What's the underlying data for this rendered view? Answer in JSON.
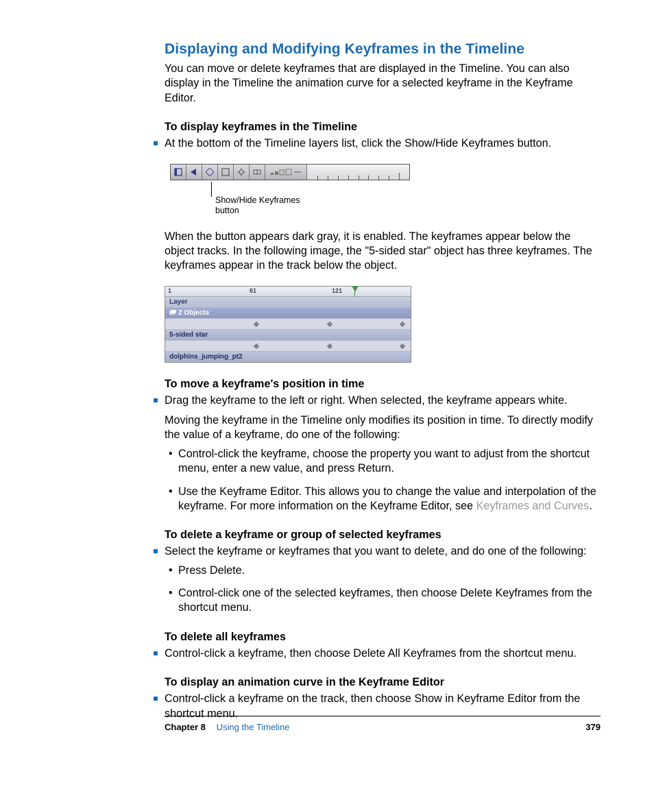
{
  "heading": "Displaying and Modifying Keyframes in the Timeline",
  "intro": "You can move or delete keyframes that are displayed in the Timeline. You can also display in the Timeline the animation curve for a selected keyframe in the Keyframe Editor.",
  "sec1": {
    "title": "To display keyframes in the Timeline",
    "bullet": "At the bottom of the Timeline layers list, click the Show/Hide Keyframes button."
  },
  "callout1": "Show/Hide Keyframes button",
  "after_fig1": "When the button appears dark gray, it is enabled. The keyframes appear below the object tracks. In the following image, the \"5-sided star\" object has three keyframes. The keyframes appear in the track below the object.",
  "fig2": {
    "ruler": {
      "a": "1",
      "b": "61",
      "c": "121"
    },
    "rows": {
      "layer": "Layer",
      "objects": "2 Objects",
      "star": "5-sided star",
      "dolphins": "dolphins_jumping_pt2"
    }
  },
  "sec2": {
    "title": "To move a keyframe's position in time",
    "bullet": "Drag the keyframe to the left or right. When selected, the keyframe appears white.",
    "para": "Moving the keyframe in the Timeline only modifies its position in time. To directly modify the value of a keyframe, do one of the following:",
    "sub1": "Control-click the keyframe, choose the property you want to adjust from the shortcut menu, enter a new value, and press Return.",
    "sub2a": "Use the Keyframe Editor. This allows you to change the value and interpolation of the keyframe. For more information on the Keyframe Editor, see ",
    "sub2link": "Keyframes and Curves",
    "sub2b": "."
  },
  "sec3": {
    "title": "To delete a keyframe or group of selected keyframes",
    "bullet": "Select the keyframe or keyframes that you want to delete, and do one of the following:",
    "sub1": "Press Delete.",
    "sub2": "Control-click one of the selected keyframes, then choose Delete Keyframes from the shortcut menu."
  },
  "sec4": {
    "title": "To delete all keyframes",
    "bullet": "Control-click a keyframe, then choose Delete All Keyframes from the shortcut menu."
  },
  "sec5": {
    "title": "To display an animation curve in the Keyframe Editor",
    "bullet": "Control-click a keyframe on the track, then choose Show in Keyframe Editor from the shortcut menu."
  },
  "footer": {
    "chapter": "Chapter 8",
    "title": "Using the Timeline",
    "page": "379"
  }
}
